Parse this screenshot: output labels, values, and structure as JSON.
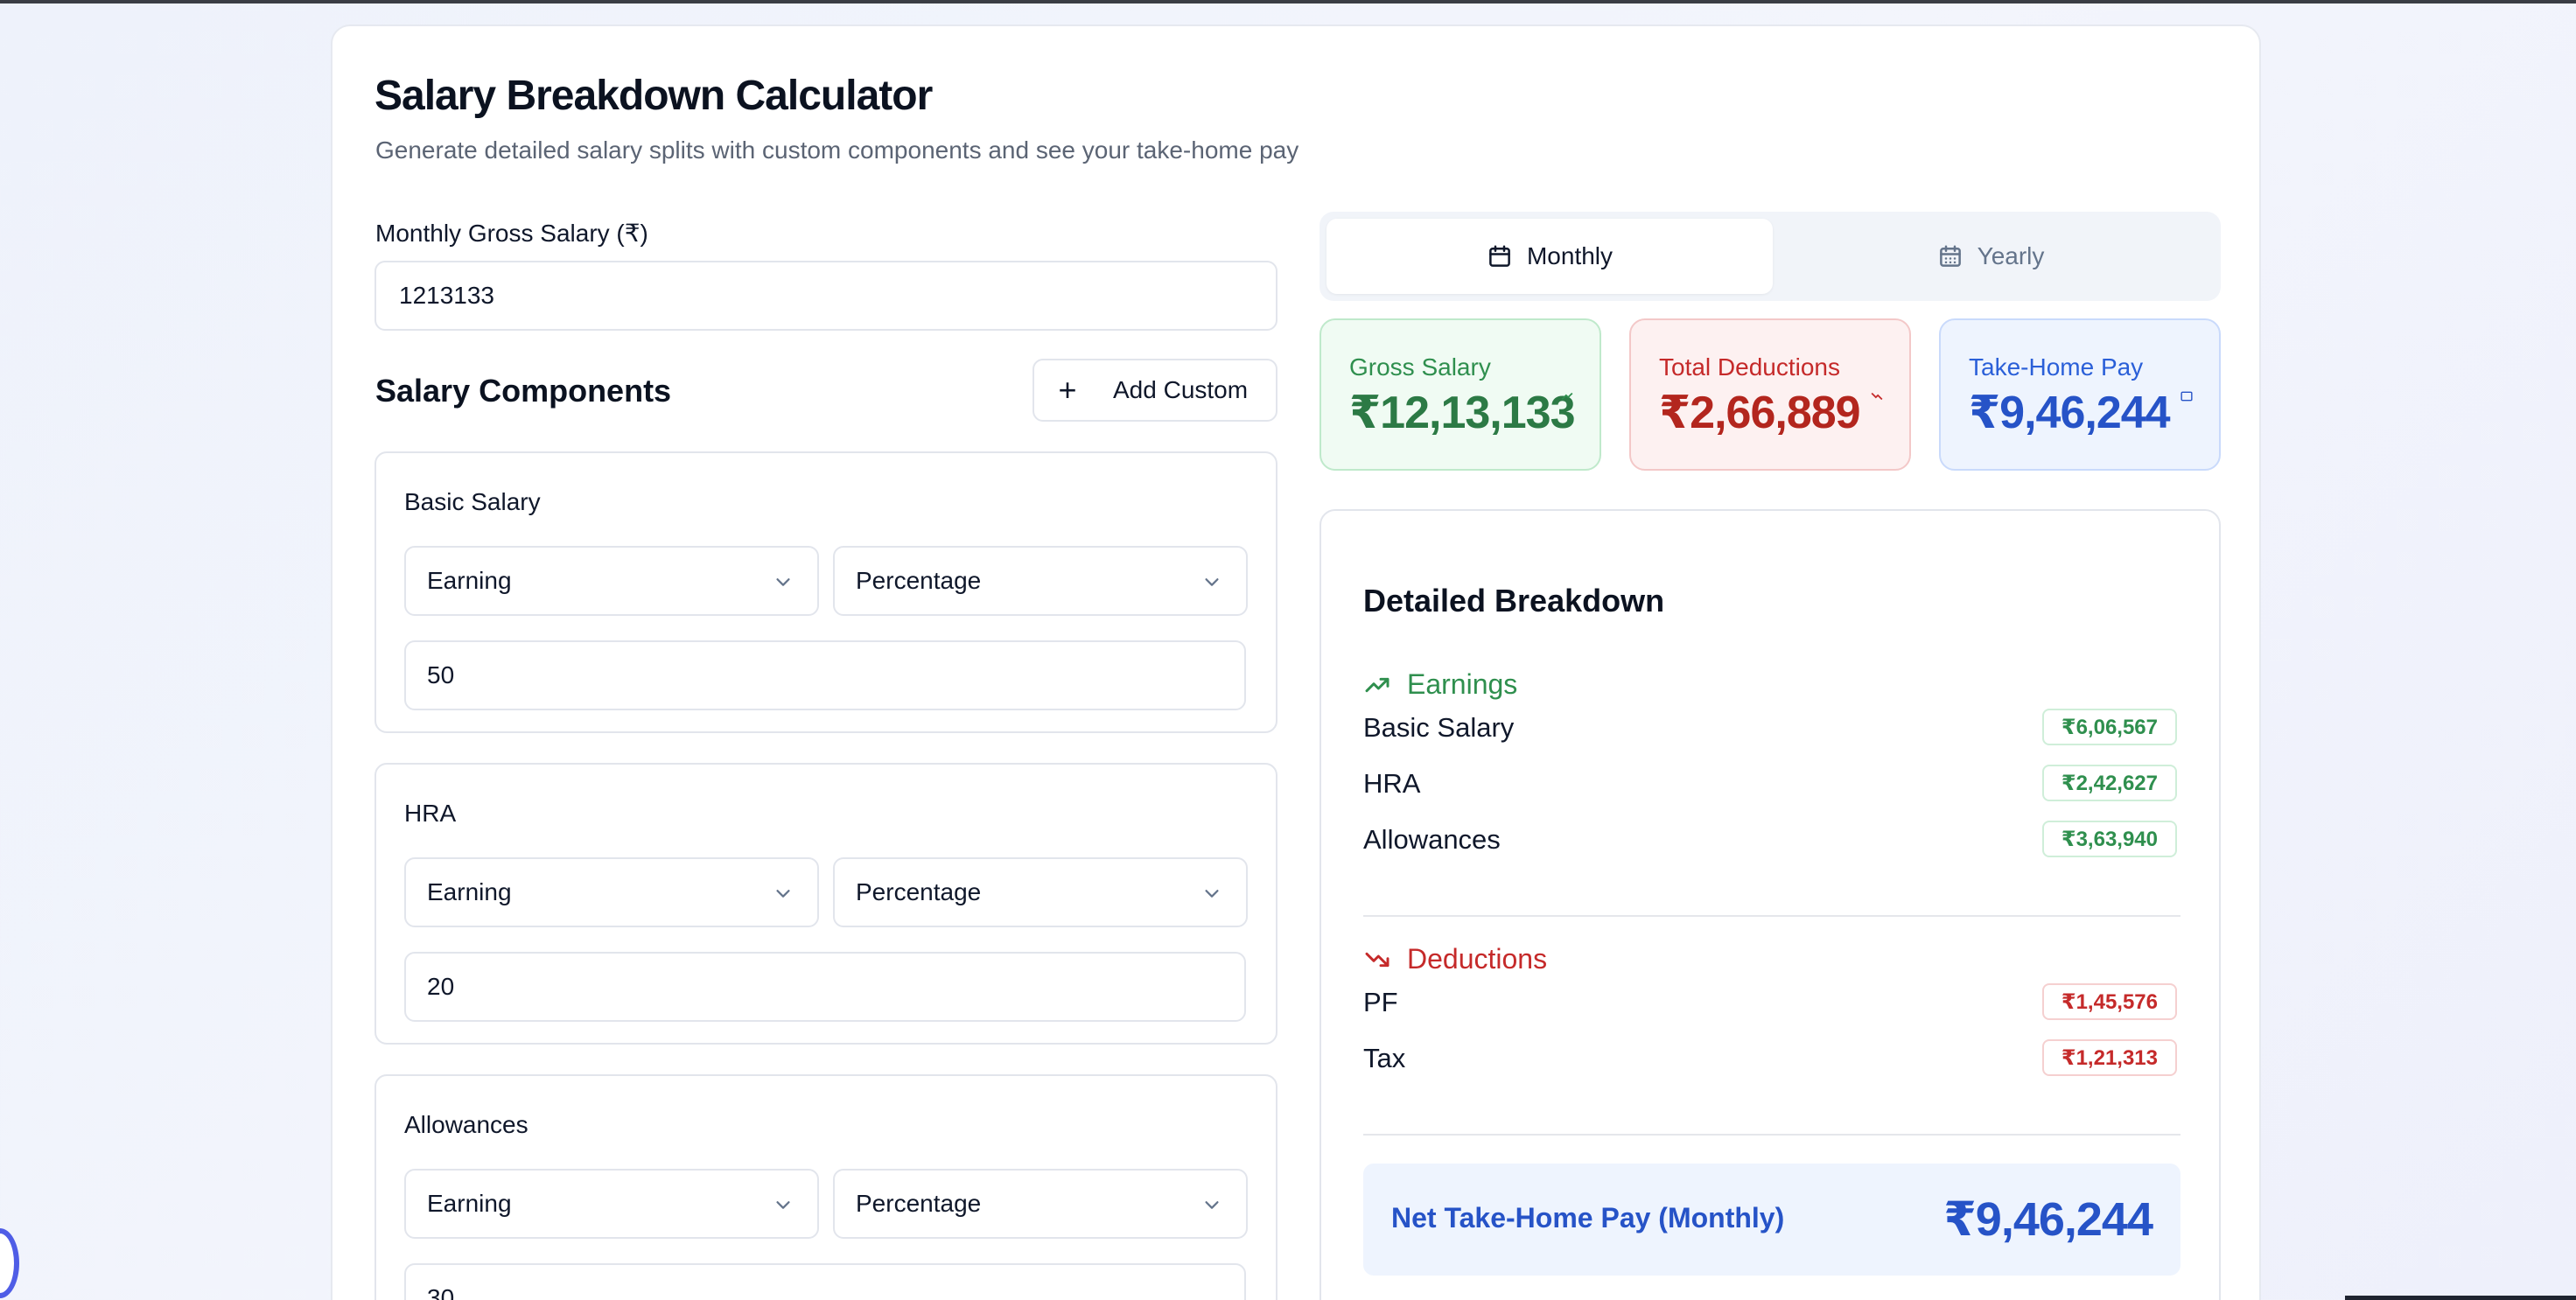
{
  "header": {
    "title": "Salary Breakdown Calculator",
    "subtitle": "Generate detailed salary splits with custom components and see your take-home pay"
  },
  "gross_input": {
    "label": "Monthly Gross Salary (₹)",
    "value": "1213133"
  },
  "components": {
    "title": "Salary Components",
    "add_label": "Add Custom",
    "items": [
      {
        "name": "Basic Salary",
        "type": "Earning",
        "mode": "Percentage",
        "value": "50"
      },
      {
        "name": "HRA",
        "type": "Earning",
        "mode": "Percentage",
        "value": "20"
      },
      {
        "name": "Allowances",
        "type": "Earning",
        "mode": "Percentage",
        "value": "30"
      }
    ]
  },
  "period_toggle": {
    "monthly": "Monthly",
    "yearly": "Yearly",
    "selected": "Monthly"
  },
  "summary": {
    "gross_label": "Gross Salary",
    "gross_value": "₹12,13,133",
    "deductions_label": "Total Deductions",
    "deductions_value": "₹2,66,889",
    "takehome_label": "Take-Home Pay",
    "takehome_value": "₹9,46,244"
  },
  "breakdown": {
    "title": "Detailed Breakdown",
    "earnings_label": "Earnings",
    "earnings": [
      {
        "label": "Basic Salary",
        "value": "₹6,06,567"
      },
      {
        "label": "HRA",
        "value": "₹2,42,627"
      },
      {
        "label": "Allowances",
        "value": "₹3,63,940"
      }
    ],
    "deductions_label": "Deductions",
    "deductions": [
      {
        "label": "PF",
        "value": "₹1,45,576"
      },
      {
        "label": "Tax",
        "value": "₹1,21,313"
      }
    ],
    "net_label": "Net Take-Home Pay (Monthly)",
    "net_value": "₹9,46,244"
  },
  "colors": {
    "earning_green": "#2f8f4e",
    "deduction_red": "#c52a2a",
    "takehome_blue": "#2653c7"
  }
}
